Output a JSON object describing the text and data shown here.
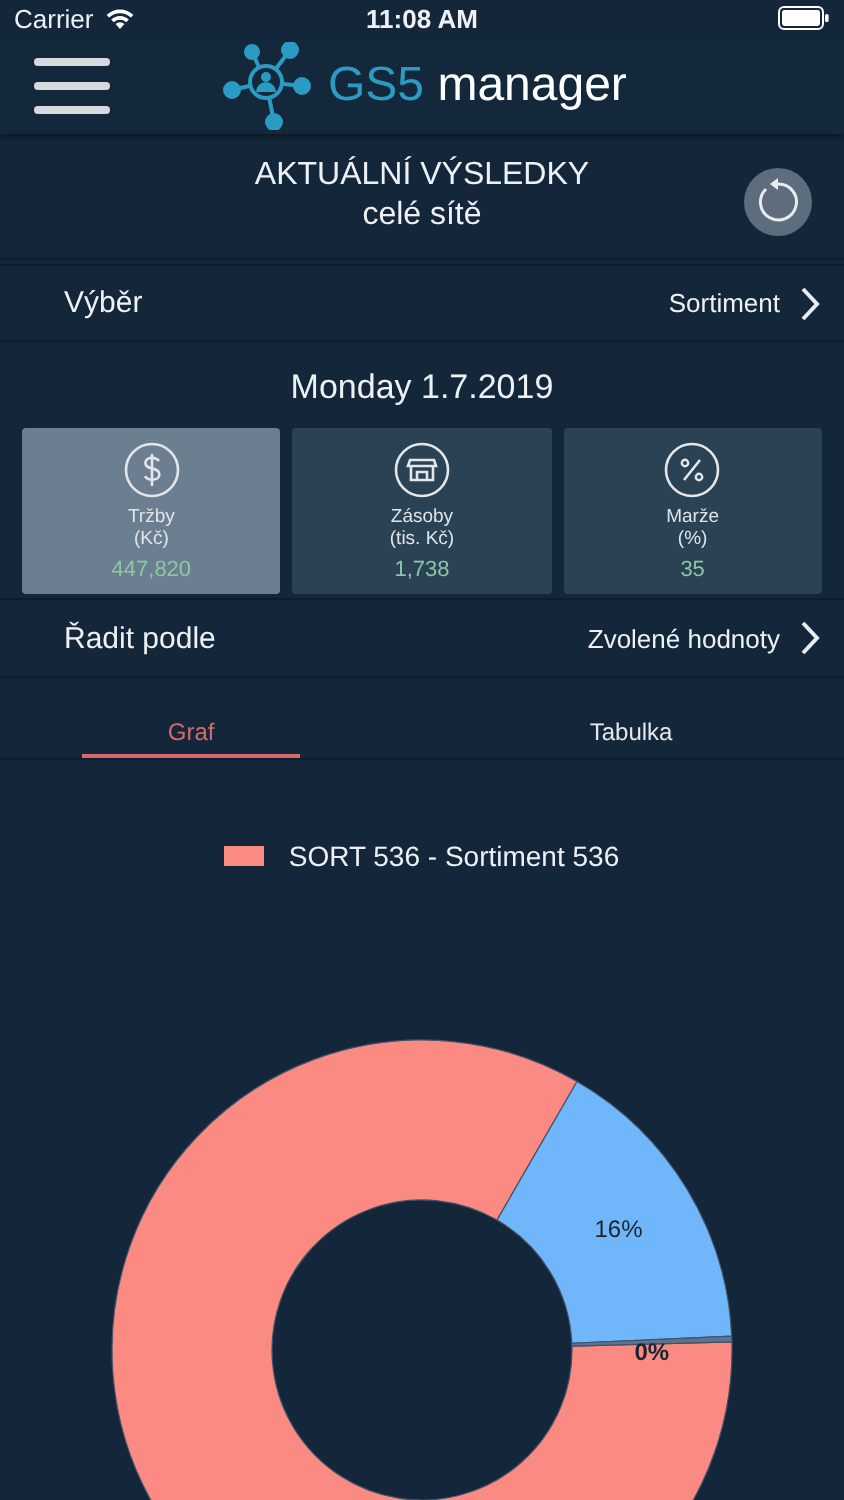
{
  "status_bar": {
    "carrier": "Carrier",
    "time": "11:08 AM"
  },
  "header": {
    "logo_prefix": "GS5",
    "logo_suffix": "manager"
  },
  "title": {
    "line1": "AKTUÁLNÍ VÝSLEDKY",
    "line2": "celé sítě"
  },
  "selection": {
    "label": "Výběr",
    "value": "Sortiment"
  },
  "date": "Monday 1.7.2019",
  "metrics": [
    {
      "kind": "money",
      "label": "Tržby",
      "unit": "(Kč)",
      "value": "447,820",
      "selected": true
    },
    {
      "kind": "store",
      "label": "Zásoby",
      "unit": "(tis. Kč)",
      "value": "1,738",
      "selected": false
    },
    {
      "kind": "percent",
      "label": "Marže",
      "unit": "(%)",
      "value": "35",
      "selected": false
    }
  ],
  "sort": {
    "label": "Řadit podle",
    "value": "Zvolené hodnoty"
  },
  "tabs": [
    {
      "label": "Graf",
      "selected": true
    },
    {
      "label": "Tabulka",
      "selected": false
    }
  ],
  "legend": [
    {
      "label": "SORT 536 - Sortiment 536",
      "color": "#fa8a82"
    }
  ],
  "chart_data": {
    "type": "donut",
    "values": [
      84,
      16,
      0.3
    ],
    "colors": [
      "#fa8a82",
      "#6fb6fb",
      "#5b7391"
    ],
    "value_labels": [
      null,
      "16%",
      "0%"
    ]
  }
}
